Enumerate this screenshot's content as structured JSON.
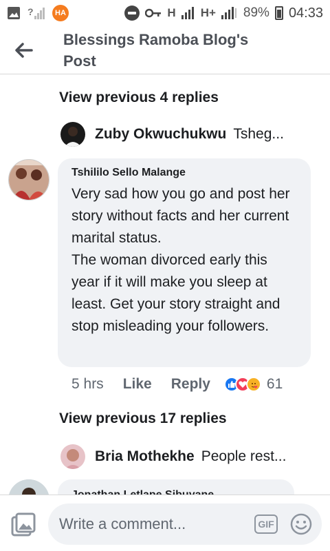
{
  "status_bar": {
    "ha_badge": "HA",
    "network_1": "H",
    "network_2": "H+",
    "battery_percent": "89%",
    "time": "04:33"
  },
  "header": {
    "title": "Blessings Ramoba Blog's Post"
  },
  "thread": {
    "view_previous_top": "View previous 4 replies",
    "preview_1": {
      "name": "Zuby Okwuchukwu",
      "snippet": "Tsheg..."
    },
    "main_comment": {
      "author": "Tshililo Sello Malange",
      "text": "Very sad how you go and post her story without facts and her current marital status.\nThe woman divorced early this year if it will make you sleep at least. Get your story straight and stop misleading your followers.",
      "time": "5 hrs",
      "like_label": "Like",
      "reply_label": "Reply",
      "reaction_icons": [
        "like-reaction-icon",
        "love-reaction-icon",
        "care-reaction-icon"
      ],
      "reaction_count": "61"
    },
    "view_previous_bottom": "View previous 17 replies",
    "preview_2": {
      "name": "Bria Mothekhe",
      "snippet": "People rest..."
    },
    "partial_comment": {
      "author": "Jonathan Letlape Sibuyane"
    }
  },
  "composer": {
    "placeholder": "Write a comment...",
    "gif_label": "GIF"
  },
  "colors": {
    "bubble_bg": "#f0f2f5",
    "meta_text": "#606770",
    "like_blue": "#1877f2",
    "love_red": "#f33e58",
    "care_yellow": "#f7b125"
  }
}
